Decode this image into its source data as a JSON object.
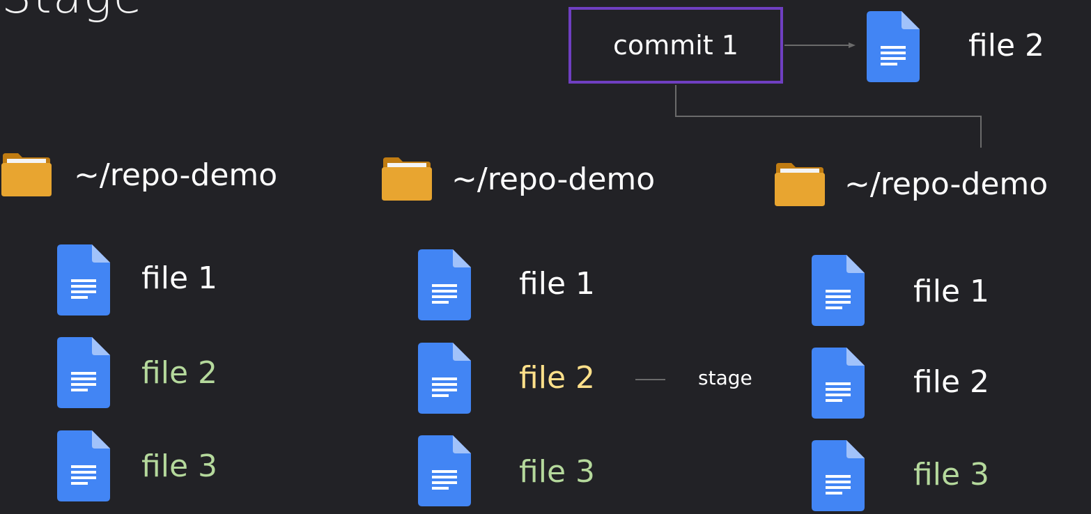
{
  "title": "Stage",
  "commit": {
    "label": "commit 1",
    "file_label": "file 2"
  },
  "columns": [
    {
      "folder": "~/repo-demo",
      "files": [
        {
          "label": "file 1",
          "color": "#ffffff"
        },
        {
          "label": "file 2",
          "color": "#b5d99c"
        },
        {
          "label": "file 3",
          "color": "#b5d99c"
        }
      ]
    },
    {
      "folder": "~/repo-demo",
      "files": [
        {
          "label": "file 1",
          "color": "#ffffff"
        },
        {
          "label": "file 2",
          "color": "#ffe08a"
        },
        {
          "label": "file 3",
          "color": "#b5d99c"
        }
      ]
    },
    {
      "folder": "~/repo-demo",
      "files": [
        {
          "label": "file 1",
          "color": "#ffffff"
        },
        {
          "label": "file 2",
          "color": "#ffffff"
        },
        {
          "label": "file 3",
          "color": "#b5d99c"
        }
      ]
    }
  ],
  "stage_label": "stage",
  "colors": {
    "background": "#222226",
    "commit_border": "#6f3fc1",
    "doc_blue": "#4285f4",
    "doc_fold": "#a1c2fa",
    "folder": "#e8a530",
    "connector": "#6b6b6b"
  },
  "icons": {
    "file": "document-icon",
    "folder": "folder-icon"
  }
}
